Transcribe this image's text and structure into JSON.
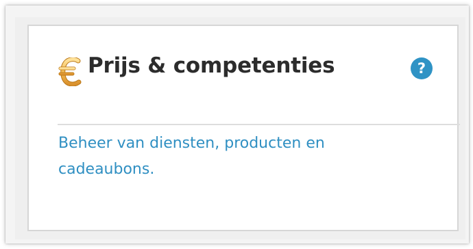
{
  "panel": {
    "title": "Prijs & competenties",
    "title_icon": "euro-icon",
    "help_icon": "question-icon",
    "help_symbol": "?",
    "description": "Beheer van diensten, producten en cadeaubons."
  },
  "colors": {
    "title": "#2c2c2c",
    "link": "#2f8fc2",
    "help_button": "#2f93c5",
    "euro_icon": "#f0b54f",
    "border": "#d6d6d6"
  }
}
